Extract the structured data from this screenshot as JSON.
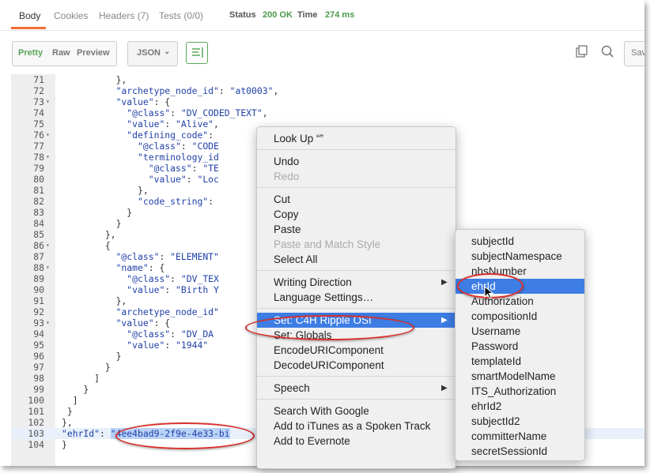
{
  "tabs": [
    {
      "label": "Body"
    },
    {
      "label": "Cookies"
    },
    {
      "label": "Headers (7)"
    },
    {
      "label": "Tests (0/0)"
    }
  ],
  "status": {
    "status_label": "Status",
    "status_value": "200 OK",
    "time_label": "Time",
    "time_value": "274 ms"
  },
  "toolbar": {
    "pretty": "Pretty",
    "raw": "Raw",
    "preview": "Preview",
    "format": "JSON",
    "save": "Sav"
  },
  "code_lines": [
    {
      "n": "71",
      "fold": "",
      "text": "          },"
    },
    {
      "n": "72",
      "fold": "",
      "text": "          \"archetype_node_id\": \"at0003\","
    },
    {
      "n": "73",
      "fold": "▾",
      "text": "          \"value\": {"
    },
    {
      "n": "74",
      "fold": "",
      "text": "            \"@class\": \"DV_CODED_TEXT\","
    },
    {
      "n": "75",
      "fold": "",
      "text": "            \"value\": \"Alive\","
    },
    {
      "n": "76",
      "fold": "▾",
      "text": "            \"defining_code\":"
    },
    {
      "n": "77",
      "fold": "",
      "text": "              \"@class\": \"CODE"
    },
    {
      "n": "78",
      "fold": "▾",
      "text": "              \"terminology_id"
    },
    {
      "n": "79",
      "fold": "",
      "text": "                \"@class\": \"TE"
    },
    {
      "n": "80",
      "fold": "",
      "text": "                \"value\": \"Loc"
    },
    {
      "n": "81",
      "fold": "",
      "text": "              },"
    },
    {
      "n": "82",
      "fold": "",
      "text": "              \"code_string\":"
    },
    {
      "n": "83",
      "fold": "",
      "text": "            }"
    },
    {
      "n": "84",
      "fold": "",
      "text": "          }"
    },
    {
      "n": "85",
      "fold": "",
      "text": "        },"
    },
    {
      "n": "86",
      "fold": "▾",
      "text": "        {"
    },
    {
      "n": "87",
      "fold": "",
      "text": "          \"@class\": \"ELEMENT\""
    },
    {
      "n": "88",
      "fold": "▾",
      "text": "          \"name\": {"
    },
    {
      "n": "89",
      "fold": "",
      "text": "            \"@class\": \"DV_TEX"
    },
    {
      "n": "90",
      "fold": "",
      "text": "            \"value\": \"Birth Y"
    },
    {
      "n": "91",
      "fold": "",
      "text": "          },"
    },
    {
      "n": "92",
      "fold": "",
      "text": "          \"archetype_node_id\""
    },
    {
      "n": "93",
      "fold": "▾",
      "text": "          \"value\": {"
    },
    {
      "n": "94",
      "fold": "",
      "text": "            \"@class\": \"DV_DA"
    },
    {
      "n": "95",
      "fold": "",
      "text": "            \"value\": \"1944\""
    },
    {
      "n": "96",
      "fold": "",
      "text": "          }"
    },
    {
      "n": "97",
      "fold": "",
      "text": "        }"
    },
    {
      "n": "98",
      "fold": "",
      "text": "      ]"
    },
    {
      "n": "99",
      "fold": "",
      "text": "    }"
    },
    {
      "n": "100",
      "fold": "",
      "text": "  ]"
    },
    {
      "n": "101",
      "fold": "",
      "text": " }"
    },
    {
      "n": "102",
      "fold": "",
      "text": "},"
    },
    {
      "n": "103",
      "fold": "",
      "text": "\"ehrId\": \"4ee4bad9-2f9e-4e33-bi",
      "highlight": true
    },
    {
      "n": "104",
      "fold": "",
      "text": "}"
    }
  ],
  "context_menu": {
    "items": [
      {
        "label": "Look Up “”",
        "type": "item"
      },
      {
        "type": "sep"
      },
      {
        "label": "Undo",
        "type": "item"
      },
      {
        "label": "Redo",
        "type": "disabled"
      },
      {
        "type": "sep"
      },
      {
        "label": "Cut",
        "type": "item"
      },
      {
        "label": "Copy",
        "type": "item"
      },
      {
        "label": "Paste",
        "type": "item"
      },
      {
        "label": "Paste and Match Style",
        "type": "disabled"
      },
      {
        "label": "Select All",
        "type": "item"
      },
      {
        "type": "sep"
      },
      {
        "label": "Writing Direction",
        "type": "submenu"
      },
      {
        "label": "Language Settings…",
        "type": "item"
      },
      {
        "type": "sep"
      },
      {
        "label": "Set: C4H Ripple OSI",
        "type": "active-submenu"
      },
      {
        "label": "Set: Globals",
        "type": "item"
      },
      {
        "label": "EncodeURIComponent",
        "type": "item"
      },
      {
        "label": "DecodeURIComponent",
        "type": "item"
      },
      {
        "type": "sep"
      },
      {
        "label": "Speech",
        "type": "submenu"
      },
      {
        "type": "sep"
      },
      {
        "label": "Search With Google",
        "type": "item"
      },
      {
        "label": "Add to iTunes as a Spoken Track",
        "type": "item"
      },
      {
        "label": "Add to Evernote",
        "type": "item"
      }
    ]
  },
  "submenu": {
    "items": [
      {
        "label": "subjectId"
      },
      {
        "label": "subjectNamespace"
      },
      {
        "label": "nhsNumber"
      },
      {
        "label": "ehrId",
        "active": true
      },
      {
        "label": "Authorization"
      },
      {
        "label": "compositionId"
      },
      {
        "label": "Username"
      },
      {
        "label": "Password"
      },
      {
        "label": "templateId"
      },
      {
        "label": "smartModelName"
      },
      {
        "label": "ITS_Authorization"
      },
      {
        "label": "ehrId2"
      },
      {
        "label": "subjectId2"
      },
      {
        "label": "committerName"
      },
      {
        "label": "secretSessionId"
      }
    ]
  },
  "colors": {
    "accent": "#f26b3a",
    "success": "#4a9a4a",
    "menu_highlight": "#3d7de4",
    "annotation": "#d9302c"
  }
}
